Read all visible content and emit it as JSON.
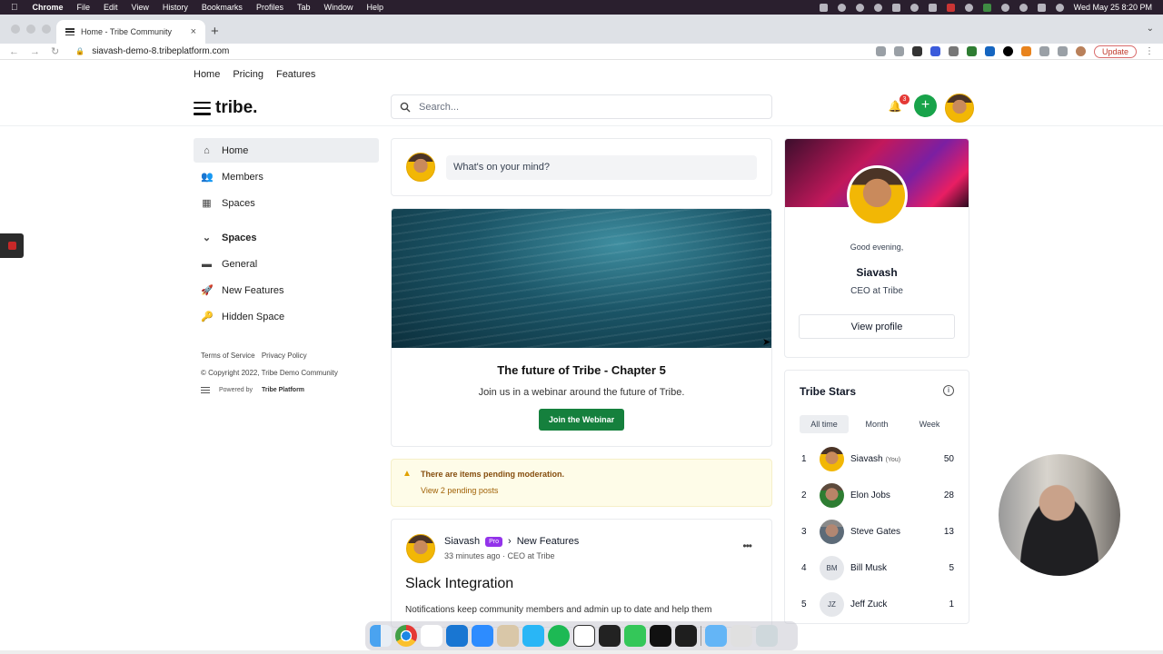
{
  "mac": {
    "app": "Chrome",
    "menus": [
      "File",
      "Edit",
      "View",
      "History",
      "Bookmarks",
      "Profiles",
      "Tab",
      "Window",
      "Help"
    ],
    "clock": "Wed May 25  8:20 PM"
  },
  "browser": {
    "tab_title": "Home - Tribe Community",
    "url": "siavash-demo-8.tribeplatform.com",
    "update_label": "Update"
  },
  "sitenav": {
    "items": [
      "Home",
      "Pricing",
      "Features"
    ]
  },
  "header": {
    "logo_text": "tribe.",
    "search_placeholder": "Search...",
    "notification_count": "3",
    "plus_symbol": "+"
  },
  "sidebar": {
    "nav": [
      {
        "label": "Home",
        "icon": "home-icon"
      },
      {
        "label": "Members",
        "icon": "members-icon"
      },
      {
        "label": "Spaces",
        "icon": "spaces-grid-icon"
      }
    ],
    "spaces_header": "Spaces",
    "spaces": [
      {
        "label": "General",
        "icon": "general-space-icon"
      },
      {
        "label": "New Features",
        "icon": "rocket-icon"
      },
      {
        "label": "Hidden Space",
        "icon": "key-icon"
      }
    ],
    "footer": {
      "terms": "Terms of Service",
      "privacy": "Privacy Policy",
      "copyright": "© Copyright 2022, Tribe Demo Community",
      "powered_prefix": "Powered by",
      "powered_name": "Tribe Platform"
    }
  },
  "composer": {
    "placeholder": "What's on your mind?"
  },
  "banner": {
    "title": "The future of Tribe - Chapter 5",
    "subtitle": "Join us in a webinar around the future of Tribe.",
    "button": "Join the Webinar"
  },
  "moderation": {
    "message": "There are items pending moderation.",
    "link": "View 2 pending posts"
  },
  "post": {
    "author": "Siavash",
    "badge": "Pro",
    "space": "New Features",
    "meta": "33 minutes ago · CEO at Tribe",
    "title": "Slack Integration",
    "excerpt": "Notifications keep community members and admin up to date and help them"
  },
  "profile": {
    "greeting": "Good evening,",
    "name": "Siavash",
    "role": "CEO at Tribe",
    "button": "View profile"
  },
  "stars": {
    "title": "Tribe Stars",
    "tabs": [
      "All time",
      "Month",
      "Week"
    ],
    "rows": [
      {
        "rank": "1",
        "name": "Siavash",
        "you": "(You)",
        "score": "50",
        "initials": ""
      },
      {
        "rank": "2",
        "name": "Elon Jobs",
        "you": "",
        "score": "28",
        "initials": ""
      },
      {
        "rank": "3",
        "name": "Steve Gates",
        "you": "",
        "score": "13",
        "initials": ""
      },
      {
        "rank": "4",
        "name": "Bill Musk",
        "you": "",
        "score": "5",
        "initials": "BM"
      },
      {
        "rank": "5",
        "name": "Jeff Zuck",
        "you": "",
        "score": "1",
        "initials": "JZ"
      }
    ]
  },
  "colors": {
    "accent_green": "#15803d",
    "badge_purple": "#9333ea",
    "warning_bg": "#fefce8"
  }
}
